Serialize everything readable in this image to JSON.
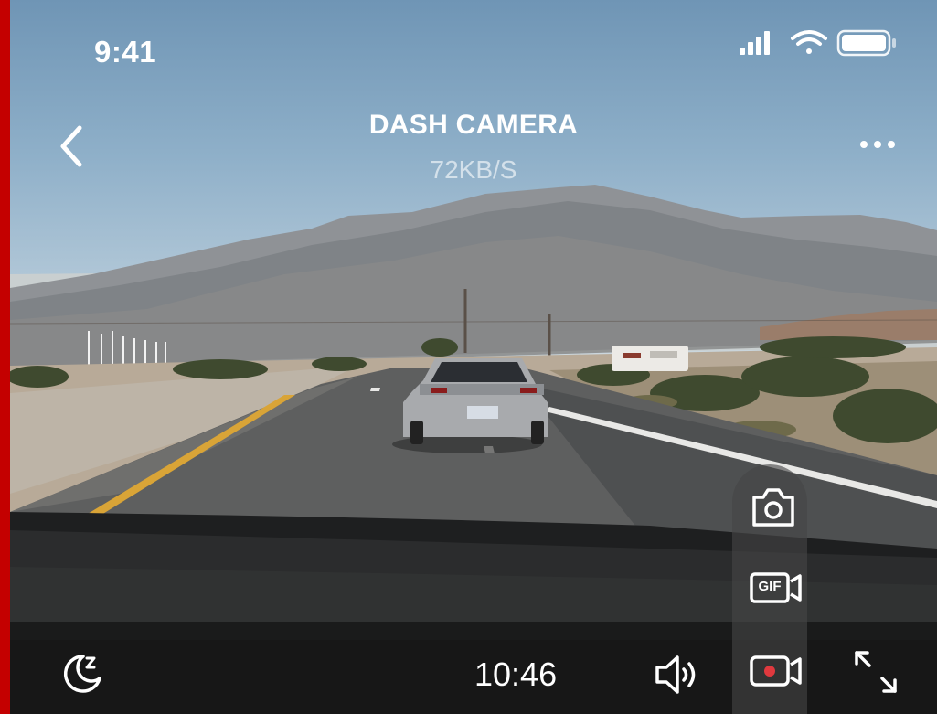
{
  "status_bar": {
    "time": "9:41"
  },
  "header": {
    "title": "DASH CAMERA",
    "transfer_rate": "72KB/S"
  },
  "bottom_bar": {
    "recording_time": "10:46"
  },
  "capture_panel": {
    "gif_label": "GIF"
  },
  "icons": [
    "signal-icon",
    "wifi-icon",
    "battery-icon",
    "back-chevron-icon",
    "more-icon",
    "camera-icon",
    "gif-video-icon",
    "record-video-icon",
    "night-mode-icon",
    "volume-icon",
    "expand-icon"
  ],
  "colors": {
    "accent_red": "#e0393e",
    "frame_red": "#c40000"
  }
}
